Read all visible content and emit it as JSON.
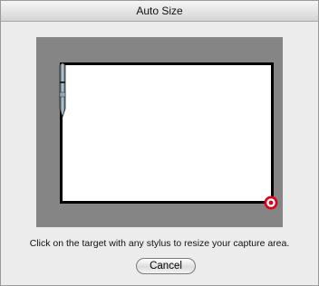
{
  "window": {
    "title": "Auto Size"
  },
  "preview": {
    "stylus_icon": "pen-stylus-icon",
    "target_icon": "resize-target-icon",
    "target_color": "#e0001b",
    "frame_color": "#000000",
    "backdrop_color": "#858585"
  },
  "instruction": "Click on the target with any stylus to resize your capture area.",
  "buttons": {
    "cancel_label": "Cancel"
  }
}
